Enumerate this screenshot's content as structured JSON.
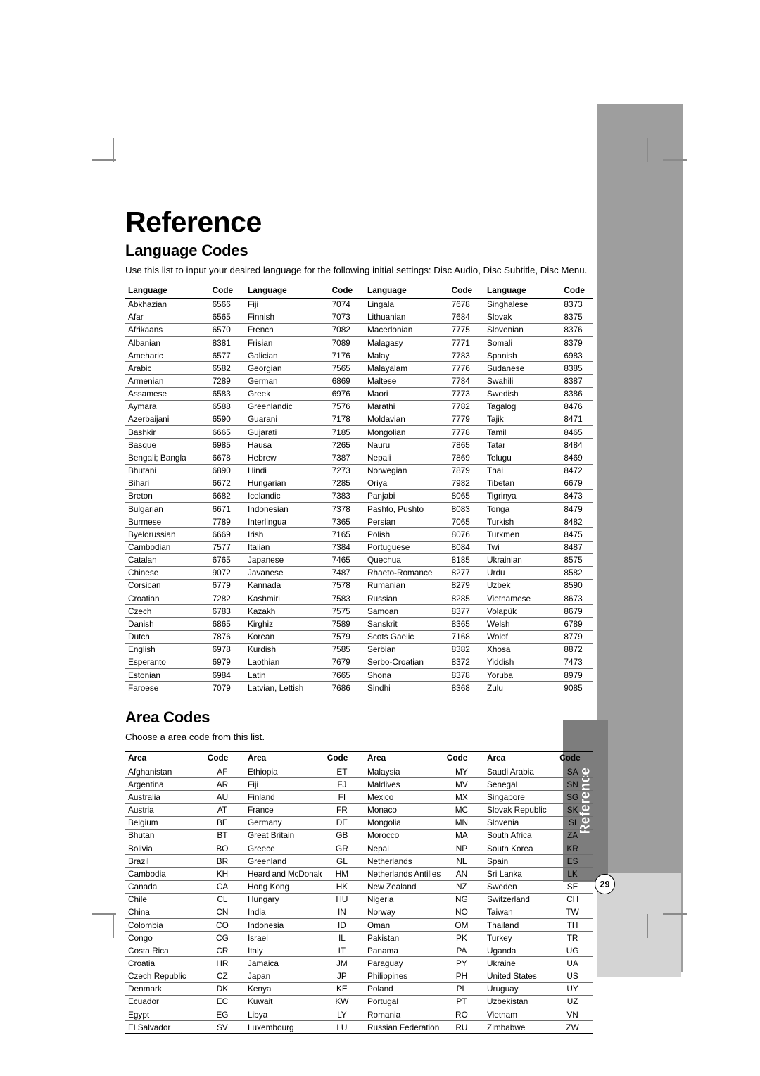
{
  "document": {
    "title": "Reference",
    "page_number": "29",
    "side_tab_label": "Reference"
  },
  "language_section": {
    "heading": "Language Codes",
    "description": "Use this list to input your desired language for the following initial settings: Disc Audio, Disc Subtitle, Disc Menu.",
    "headers": {
      "name": "Language",
      "code": "Code"
    },
    "columns": [
      [
        [
          "Abkhazian",
          "6566"
        ],
        [
          "Afar",
          "6565"
        ],
        [
          "Afrikaans",
          "6570"
        ],
        [
          "Albanian",
          "8381"
        ],
        [
          "Ameharic",
          "6577"
        ],
        [
          "Arabic",
          "6582"
        ],
        [
          "Armenian",
          "7289"
        ],
        [
          "Assamese",
          "6583"
        ],
        [
          "Aymara",
          "6588"
        ],
        [
          "Azerbaijani",
          "6590"
        ],
        [
          "Bashkir",
          "6665"
        ],
        [
          "Basque",
          "6985"
        ],
        [
          "Bengali; Bangla",
          "6678"
        ],
        [
          "Bhutani",
          "6890"
        ],
        [
          "Bihari",
          "6672"
        ],
        [
          "Breton",
          "6682"
        ],
        [
          "Bulgarian",
          "6671"
        ],
        [
          "Burmese",
          "7789"
        ],
        [
          "Byelorussian",
          "6669"
        ],
        [
          "Cambodian",
          "7577"
        ],
        [
          "Catalan",
          "6765"
        ],
        [
          "Chinese",
          "9072"
        ],
        [
          "Corsican",
          "6779"
        ],
        [
          "Croatian",
          "7282"
        ],
        [
          "Czech",
          "6783"
        ],
        [
          "Danish",
          "6865"
        ],
        [
          "Dutch",
          "7876"
        ],
        [
          "English",
          "6978"
        ],
        [
          "Esperanto",
          "6979"
        ],
        [
          "Estonian",
          "6984"
        ],
        [
          "Faroese",
          "7079"
        ]
      ],
      [
        [
          "Fiji",
          "7074"
        ],
        [
          "Finnish",
          "7073"
        ],
        [
          "French",
          "7082"
        ],
        [
          "Frisian",
          "7089"
        ],
        [
          "Galician",
          "7176"
        ],
        [
          "Georgian",
          "7565"
        ],
        [
          "German",
          "6869"
        ],
        [
          "Greek",
          "6976"
        ],
        [
          "Greenlandic",
          "7576"
        ],
        [
          "Guarani",
          "7178"
        ],
        [
          "Gujarati",
          "7185"
        ],
        [
          "Hausa",
          "7265"
        ],
        [
          "Hebrew",
          "7387"
        ],
        [
          "Hindi",
          "7273"
        ],
        [
          "Hungarian",
          "7285"
        ],
        [
          "Icelandic",
          "7383"
        ],
        [
          "Indonesian",
          "7378"
        ],
        [
          "Interlingua",
          "7365"
        ],
        [
          "Irish",
          "7165"
        ],
        [
          "Italian",
          "7384"
        ],
        [
          "Japanese",
          "7465"
        ],
        [
          "Javanese",
          "7487"
        ],
        [
          "Kannada",
          "7578"
        ],
        [
          "Kashmiri",
          "7583"
        ],
        [
          "Kazakh",
          "7575"
        ],
        [
          "Kirghiz",
          "7589"
        ],
        [
          "Korean",
          "7579"
        ],
        [
          "Kurdish",
          "7585"
        ],
        [
          "Laothian",
          "7679"
        ],
        [
          "Latin",
          "7665"
        ],
        [
          "Latvian, Lettish",
          "7686"
        ]
      ],
      [
        [
          "Lingala",
          "7678"
        ],
        [
          "Lithuanian",
          "7684"
        ],
        [
          "Macedonian",
          "7775"
        ],
        [
          "Malagasy",
          "7771"
        ],
        [
          "Malay",
          "7783"
        ],
        [
          "Malayalam",
          "7776"
        ],
        [
          "Maltese",
          "7784"
        ],
        [
          "Maori",
          "7773"
        ],
        [
          "Marathi",
          "7782"
        ],
        [
          "Moldavian",
          "7779"
        ],
        [
          "Mongolian",
          "7778"
        ],
        [
          "Nauru",
          "7865"
        ],
        [
          "Nepali",
          "7869"
        ],
        [
          "Norwegian",
          "7879"
        ],
        [
          "Oriya",
          "7982"
        ],
        [
          "Panjabi",
          "8065"
        ],
        [
          "Pashto, Pushto",
          "8083"
        ],
        [
          "Persian",
          "7065"
        ],
        [
          "Polish",
          "8076"
        ],
        [
          "Portuguese",
          "8084"
        ],
        [
          "Quechua",
          "8185"
        ],
        [
          "Rhaeto-Romance",
          "8277"
        ],
        [
          "Rumanian",
          "8279"
        ],
        [
          "Russian",
          "8285"
        ],
        [
          "Samoan",
          "8377"
        ],
        [
          "Sanskrit",
          "8365"
        ],
        [
          "Scots Gaelic",
          "7168"
        ],
        [
          "Serbian",
          "8382"
        ],
        [
          "Serbo-Croatian",
          "8372"
        ],
        [
          "Shona",
          "8378"
        ],
        [
          "Sindhi",
          "8368"
        ]
      ],
      [
        [
          "Singhalese",
          "8373"
        ],
        [
          "Slovak",
          "8375"
        ],
        [
          "Slovenian",
          "8376"
        ],
        [
          "Somali",
          "8379"
        ],
        [
          "Spanish",
          "6983"
        ],
        [
          "Sudanese",
          "8385"
        ],
        [
          "Swahili",
          "8387"
        ],
        [
          "Swedish",
          "8386"
        ],
        [
          "Tagalog",
          "8476"
        ],
        [
          "Tajik",
          "8471"
        ],
        [
          "Tamil",
          "8465"
        ],
        [
          "Tatar",
          "8484"
        ],
        [
          "Telugu",
          "8469"
        ],
        [
          "Thai",
          "8472"
        ],
        [
          "Tibetan",
          "6679"
        ],
        [
          "Tigrinya",
          "8473"
        ],
        [
          "Tonga",
          "8479"
        ],
        [
          "Turkish",
          "8482"
        ],
        [
          "Turkmen",
          "8475"
        ],
        [
          "Twi",
          "8487"
        ],
        [
          "Ukrainian",
          "8575"
        ],
        [
          "Urdu",
          "8582"
        ],
        [
          "Uzbek",
          "8590"
        ],
        [
          "Vietnamese",
          "8673"
        ],
        [
          "Volapük",
          "8679"
        ],
        [
          "Welsh",
          "6789"
        ],
        [
          "Wolof",
          "8779"
        ],
        [
          "Xhosa",
          "8872"
        ],
        [
          "Yiddish",
          "7473"
        ],
        [
          "Yoruba",
          "8979"
        ],
        [
          "Zulu",
          "9085"
        ]
      ]
    ]
  },
  "area_section": {
    "heading": "Area Codes",
    "description": "Choose a area code from this list.",
    "headers": {
      "name": "Area",
      "code": "Code"
    },
    "columns": [
      [
        [
          "Afghanistan",
          "AF"
        ],
        [
          "Argentina",
          "AR"
        ],
        [
          "Australia",
          "AU"
        ],
        [
          "Austria",
          "AT"
        ],
        [
          "Belgium",
          "BE"
        ],
        [
          "Bhutan",
          "BT"
        ],
        [
          "Bolivia",
          "BO"
        ],
        [
          "Brazil",
          "BR"
        ],
        [
          "Cambodia",
          "KH"
        ],
        [
          "Canada",
          "CA"
        ],
        [
          "Chile",
          "CL"
        ],
        [
          "China",
          "CN"
        ],
        [
          "Colombia",
          "CO"
        ],
        [
          "Congo",
          "CG"
        ],
        [
          "Costa Rica",
          "CR"
        ],
        [
          "Croatia",
          "HR"
        ],
        [
          "Czech Republic",
          "CZ"
        ],
        [
          "Denmark",
          "DK"
        ],
        [
          "Ecuador",
          "EC"
        ],
        [
          "Egypt",
          "EG"
        ],
        [
          "El Salvador",
          "SV"
        ]
      ],
      [
        [
          "Ethiopia",
          "ET"
        ],
        [
          "Fiji",
          "FJ"
        ],
        [
          "Finland",
          "FI"
        ],
        [
          "France",
          "FR"
        ],
        [
          "Germany",
          "DE"
        ],
        [
          "Great Britain",
          "GB"
        ],
        [
          "Greece",
          "GR"
        ],
        [
          "Greenland",
          "GL"
        ],
        [
          "Heard and McDonald Islands",
          "HM"
        ],
        [
          "Hong Kong",
          "HK"
        ],
        [
          "Hungary",
          "HU"
        ],
        [
          "India",
          "IN"
        ],
        [
          "Indonesia",
          "ID"
        ],
        [
          "Israel",
          "IL"
        ],
        [
          "Italy",
          "IT"
        ],
        [
          "Jamaica",
          "JM"
        ],
        [
          "Japan",
          "JP"
        ],
        [
          "Kenya",
          "KE"
        ],
        [
          "Kuwait",
          "KW"
        ],
        [
          "Libya",
          "LY"
        ],
        [
          "Luxembourg",
          "LU"
        ]
      ],
      [
        [
          "Malaysia",
          "MY"
        ],
        [
          "Maldives",
          "MV"
        ],
        [
          "Mexico",
          "MX"
        ],
        [
          "Monaco",
          "MC"
        ],
        [
          "Mongolia",
          "MN"
        ],
        [
          "Morocco",
          "MA"
        ],
        [
          "Nepal",
          "NP"
        ],
        [
          "Netherlands",
          "NL"
        ],
        [
          "Netherlands Antilles",
          "AN"
        ],
        [
          "New Zealand",
          "NZ"
        ],
        [
          "Nigeria",
          "NG"
        ],
        [
          "Norway",
          "NO"
        ],
        [
          "Oman",
          "OM"
        ],
        [
          "Pakistan",
          "PK"
        ],
        [
          "Panama",
          "PA"
        ],
        [
          "Paraguay",
          "PY"
        ],
        [
          "Philippines",
          "PH"
        ],
        [
          "Poland",
          "PL"
        ],
        [
          "Portugal",
          "PT"
        ],
        [
          "Romania",
          "RO"
        ],
        [
          "Russian Federation",
          "RU"
        ]
      ],
      [
        [
          "Saudi Arabia",
          "SA"
        ],
        [
          "Senegal",
          "SN"
        ],
        [
          "Singapore",
          "SG"
        ],
        [
          "Slovak Republic",
          "SK"
        ],
        [
          "Slovenia",
          "SI"
        ],
        [
          "South Africa",
          "ZA"
        ],
        [
          "South Korea",
          "KR"
        ],
        [
          "Spain",
          "ES"
        ],
        [
          "Sri Lanka",
          "LK"
        ],
        [
          "Sweden",
          "SE"
        ],
        [
          "Switzerland",
          "CH"
        ],
        [
          "Taiwan",
          "TW"
        ],
        [
          "Thailand",
          "TH"
        ],
        [
          "Turkey",
          "TR"
        ],
        [
          "Uganda",
          "UG"
        ],
        [
          "Ukraine",
          "UA"
        ],
        [
          "United States",
          "US"
        ],
        [
          "Uruguay",
          "UY"
        ],
        [
          "Uzbekistan",
          "UZ"
        ],
        [
          "Vietnam",
          "VN"
        ],
        [
          "Zimbabwe",
          "ZW"
        ]
      ]
    ]
  }
}
